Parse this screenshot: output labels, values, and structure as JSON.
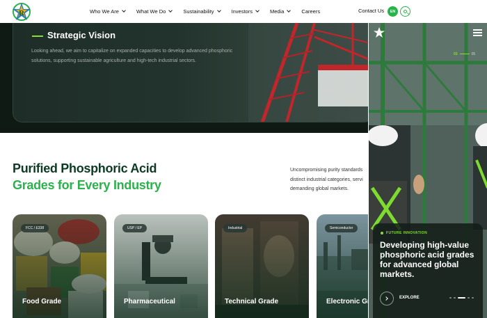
{
  "header": {
    "nav": [
      {
        "label": "Who We Are",
        "has_dropdown": true
      },
      {
        "label": "What We Do",
        "has_dropdown": true
      },
      {
        "label": "Sustainability",
        "has_dropdown": true
      },
      {
        "label": "Investors",
        "has_dropdown": true
      },
      {
        "label": "Media",
        "has_dropdown": true
      },
      {
        "label": "Careers",
        "has_dropdown": false
      }
    ],
    "contact_label": "Contact Us",
    "language_label": "EN",
    "search_icon": "search-icon"
  },
  "vision": {
    "title": "Strategic Vision",
    "body": "Looking ahead, we aim to capitalize on expanded capacities to develop advanced phosphoric solutions, supporting sustainable agriculture and high-tech industrial sectors."
  },
  "grades": {
    "heading_line1": "Purified Phosphoric Acid",
    "heading_line2": "Grades for Every Industry",
    "description_lines": [
      "Uncompromising purity standards",
      "distinct industrial categories, servi",
      "demanding global markets."
    ],
    "cards": [
      {
        "tag": "FCC / E338",
        "name": "Food Grade"
      },
      {
        "tag": "USP / EP",
        "name": "Pharmaceutical"
      },
      {
        "tag": "Industrial",
        "name": "Technical Grade"
      },
      {
        "tag": "Semiconductor",
        "name": "Electronic Gra"
      }
    ]
  },
  "slider": {
    "counter_current": "03",
    "counter_total": "05",
    "kicker": "FUTURE INNOVATION",
    "title": "Developing high-value phosphoric acid grades for advanced global markets.",
    "explore_label": "EXPLORE",
    "active_slide_index": 2,
    "slide_count": 5
  },
  "colors": {
    "brand_green": "#2bb24c",
    "accent_lime": "#8bdc35",
    "heading_dark_green": "#0d3a24",
    "hero_dark": "#0f1a15"
  }
}
